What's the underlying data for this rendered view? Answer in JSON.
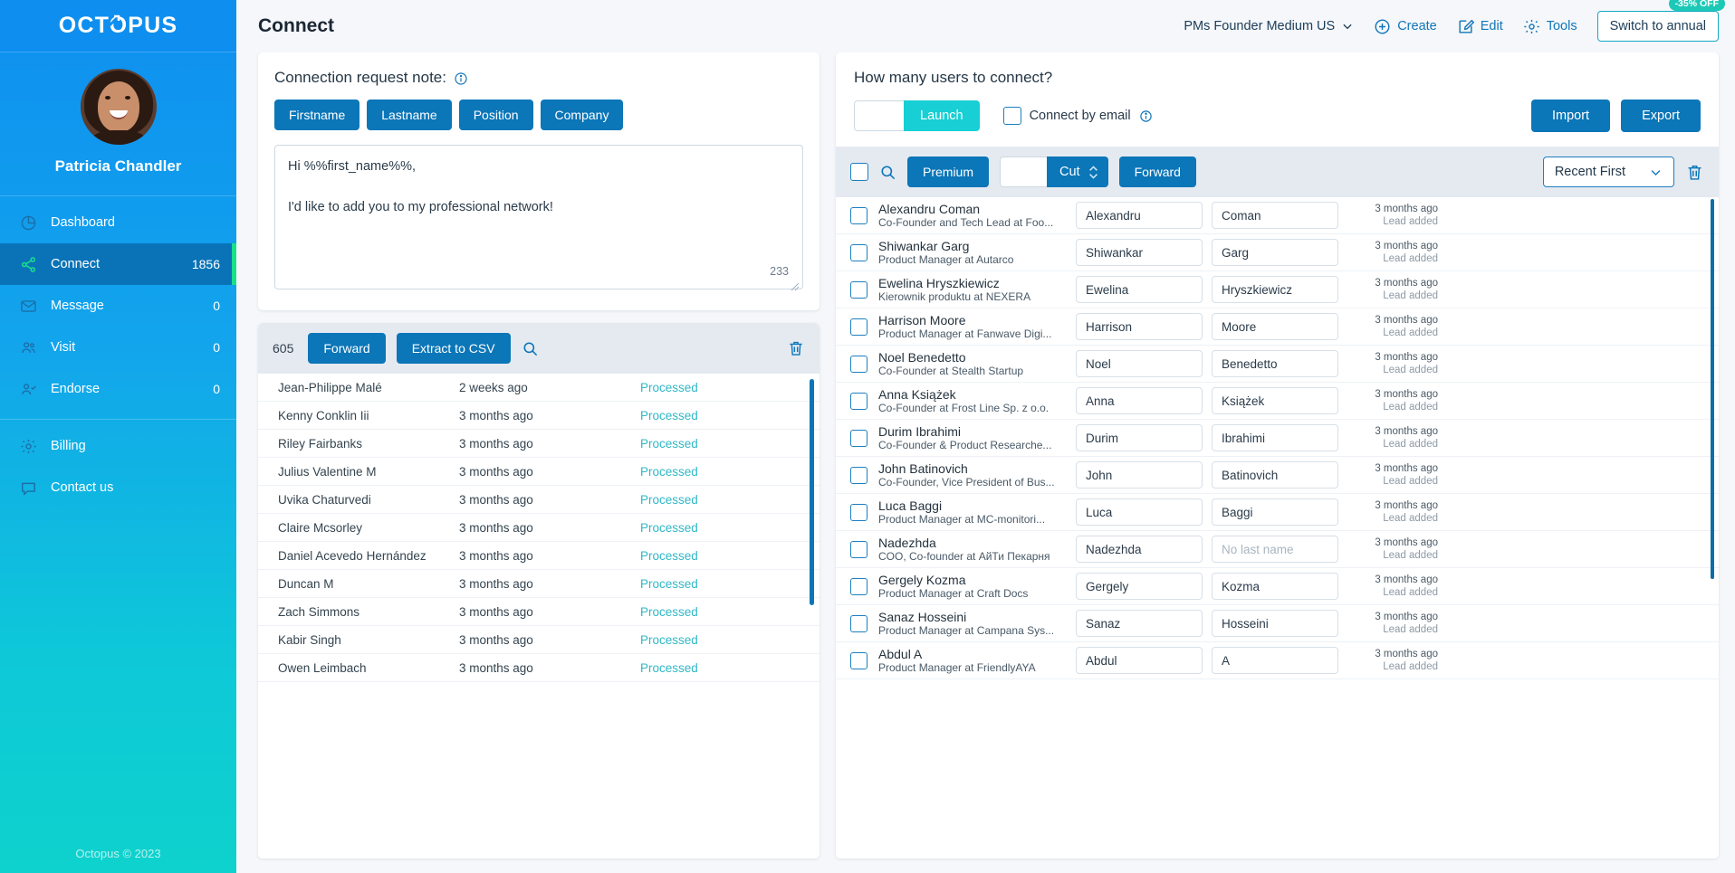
{
  "brand": {
    "logo_text": "OCTOPUS",
    "accent": "#0b76b8",
    "teal": "#17cfd4",
    "green": "#18e08a"
  },
  "sidebar": {
    "profile_name": "Patricia Chandler",
    "items": [
      {
        "label": "Dashboard",
        "count": "",
        "icon": "dashboard-icon",
        "active": false
      },
      {
        "label": "Connect",
        "count": "1856",
        "icon": "share-icon",
        "active": true
      },
      {
        "label": "Message",
        "count": "0",
        "icon": "envelope-icon",
        "active": false
      },
      {
        "label": "Visit",
        "count": "0",
        "icon": "users-icon",
        "active": false
      },
      {
        "label": "Endorse",
        "count": "0",
        "icon": "user-check-icon",
        "active": false
      }
    ],
    "secondary": [
      {
        "label": "Billing",
        "icon": "gear-icon"
      },
      {
        "label": "Contact us",
        "icon": "chat-icon"
      }
    ],
    "footer": "Octopus © 2023"
  },
  "topbar": {
    "page_title": "Connect",
    "account": "PMs Founder Medium US",
    "create_label": "Create",
    "edit_label": "Edit",
    "tools_label": "Tools",
    "switch_label": "Switch to annual",
    "discount_badge": "-35% OFF"
  },
  "note_card": {
    "title": "Connection request note:",
    "tags": [
      "Firstname",
      "Lastname",
      "Position",
      "Company"
    ],
    "text": "Hi %%first_name%%,\n\nI'd like to add you to my professional network!",
    "char_count": "233"
  },
  "history_list": {
    "count": "605",
    "forward_label": "Forward",
    "extract_label": "Extract to CSV",
    "rows": [
      {
        "name": "Jean-Philippe Malé",
        "time": "2 weeks ago",
        "status": "Processed"
      },
      {
        "name": "Kenny Conklin Iii",
        "time": "3 months ago",
        "status": "Processed"
      },
      {
        "name": "Riley Fairbanks",
        "time": "3 months ago",
        "status": "Processed"
      },
      {
        "name": "Julius Valentine M",
        "time": "3 months ago",
        "status": "Processed"
      },
      {
        "name": "Uvika Chaturvedi",
        "time": "3 months ago",
        "status": "Processed"
      },
      {
        "name": "Claire Mcsorley",
        "time": "3 months ago",
        "status": "Processed"
      },
      {
        "name": "Daniel Acevedo Hernández",
        "time": "3 months ago",
        "status": "Processed"
      },
      {
        "name": "Duncan M",
        "time": "3 months ago",
        "status": "Processed"
      },
      {
        "name": "Zach Simmons",
        "time": "3 months ago",
        "status": "Processed"
      },
      {
        "name": "Kabir Singh",
        "time": "3 months ago",
        "status": "Processed"
      },
      {
        "name": "Owen Leimbach",
        "time": "3 months ago",
        "status": "Processed"
      }
    ]
  },
  "connect_panel": {
    "question": "How many users to connect?",
    "amount_value": "",
    "launch_label": "Launch",
    "connect_by_email_label": "Connect by email",
    "import_label": "Import",
    "export_label": "Export",
    "toolbar": {
      "premium_label": "Premium",
      "cut_value": "",
      "cut_label": "Cut",
      "forward_label": "Forward",
      "sort_label": "Recent First"
    },
    "rows": [
      {
        "name": "Alexandru Coman",
        "title": "Co-Founder and Tech Lead at Foo...",
        "first": "Alexandru",
        "last": "Coman",
        "last_placeholder": "",
        "time": "3 months ago",
        "event": "Lead added"
      },
      {
        "name": "Shiwankar Garg",
        "title": "Product Manager at Autarco",
        "first": "Shiwankar",
        "last": "Garg",
        "last_placeholder": "",
        "time": "3 months ago",
        "event": "Lead added"
      },
      {
        "name": "Ewelina Hryszkiewicz",
        "title": "Kierownik produktu at NEXERA",
        "first": "Ewelina",
        "last": "Hryszkiewicz",
        "last_placeholder": "",
        "time": "3 months ago",
        "event": "Lead added"
      },
      {
        "name": "Harrison Moore",
        "title": "Product Manager at Fanwave Digi...",
        "first": "Harrison",
        "last": "Moore",
        "last_placeholder": "",
        "time": "3 months ago",
        "event": "Lead added"
      },
      {
        "name": "Noel Benedetto",
        "title": "Co-Founder at Stealth Startup",
        "first": "Noel",
        "last": "Benedetto",
        "last_placeholder": "",
        "time": "3 months ago",
        "event": "Lead added"
      },
      {
        "name": "Anna Książek",
        "title": "Co-Founder at Frost Line Sp. z o.o.",
        "first": "Anna",
        "last": "Książek",
        "last_placeholder": "",
        "time": "3 months ago",
        "event": "Lead added"
      },
      {
        "name": "Durim Ibrahimi",
        "title": "Co-Founder & Product Researche...",
        "first": "Durim",
        "last": "Ibrahimi",
        "last_placeholder": "",
        "time": "3 months ago",
        "event": "Lead added"
      },
      {
        "name": "John Batinovich",
        "title": "Co-Founder, Vice President of Bus...",
        "first": "John",
        "last": "Batinovich",
        "last_placeholder": "",
        "time": "3 months ago",
        "event": "Lead added"
      },
      {
        "name": "Luca Baggi",
        "title": "Product Manager at MC-monitori...",
        "first": "Luca",
        "last": "Baggi",
        "last_placeholder": "",
        "time": "3 months ago",
        "event": "Lead added"
      },
      {
        "name": "Nadezhda",
        "title": "COO, Co-founder at АйТи Пекарня",
        "first": "Nadezhda",
        "last": "",
        "last_placeholder": "No last name",
        "time": "3 months ago",
        "event": "Lead added"
      },
      {
        "name": "Gergely Kozma",
        "title": "Product Manager at Craft Docs",
        "first": "Gergely",
        "last": "Kozma",
        "last_placeholder": "",
        "time": "3 months ago",
        "event": "Lead added"
      },
      {
        "name": "Sanaz Hosseini",
        "title": "Product Manager at Campana Sys...",
        "first": "Sanaz",
        "last": "Hosseini",
        "last_placeholder": "",
        "time": "3 months ago",
        "event": "Lead added"
      },
      {
        "name": "Abdul A",
        "title": "Product Manager at FriendlyAYA",
        "first": "Abdul",
        "last": "A",
        "last_placeholder": "",
        "time": "3 months ago",
        "event": "Lead added"
      }
    ]
  }
}
